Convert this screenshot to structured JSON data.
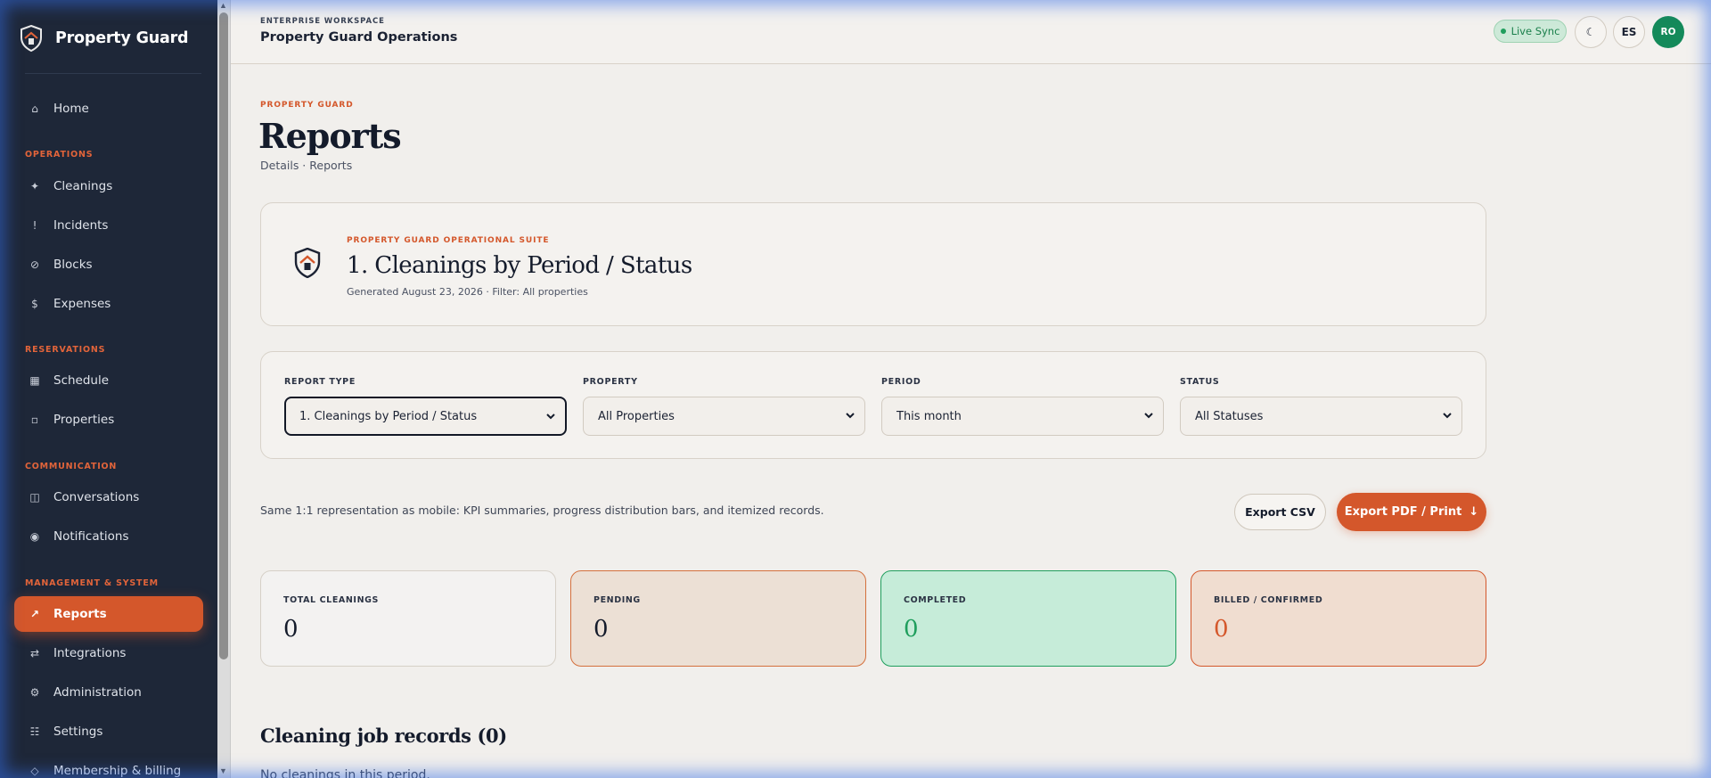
{
  "brand": {
    "name": "Property Guard"
  },
  "sidebar": {
    "sections": {
      "operations": "OPERATIONS",
      "reservations": "RESERVATIONS",
      "communication": "COMMUNICATION",
      "management": "MANAGEMENT & SYSTEM"
    },
    "items": {
      "home": {
        "label": "Home",
        "icon": "⌂"
      },
      "cleanings": {
        "label": "Cleanings",
        "icon": "✦"
      },
      "incidents": {
        "label": "Incidents",
        "icon": "!"
      },
      "blocks": {
        "label": "Blocks",
        "icon": "⊘"
      },
      "expenses": {
        "label": "Expenses",
        "icon": "$"
      },
      "schedule": {
        "label": "Schedule",
        "icon": "▦"
      },
      "properties": {
        "label": "Properties",
        "icon": "▫"
      },
      "conversations": {
        "label": "Conversations",
        "icon": "◫"
      },
      "notifications": {
        "label": "Notifications",
        "icon": "◉"
      },
      "reports": {
        "label": "Reports",
        "icon": "↗"
      },
      "integrations": {
        "label": "Integrations",
        "icon": "⇄"
      },
      "administration": {
        "label": "Administration",
        "icon": "⚙"
      },
      "settings": {
        "label": "Settings",
        "icon": "☷"
      },
      "membership": {
        "label": "Membership & billing",
        "icon": "◇"
      }
    }
  },
  "topbar": {
    "eyebrow": "ENTERPRISE WORKSPACE",
    "title": "Property Guard Operations",
    "live_sync": "Live Sync",
    "theme_icon": "☾",
    "lang": "ES",
    "avatar": "RO"
  },
  "page": {
    "eyebrow": "PROPERTY GUARD",
    "title": "Reports",
    "breadcrumb": "Details · Reports"
  },
  "report_header": {
    "eyebrow": "PROPERTY GUARD OPERATIONAL SUITE",
    "title": "1. Cleanings by Period / Status",
    "meta": "Generated August 23, 2026 · Filter: All properties"
  },
  "filters": {
    "report_type": {
      "label": "REPORT TYPE",
      "value": "1. Cleanings by Period / Status"
    },
    "property": {
      "label": "PROPERTY",
      "value": "All Properties"
    },
    "period": {
      "label": "PERIOD",
      "value": "This month"
    },
    "status": {
      "label": "STATUS",
      "value": "All Statuses"
    }
  },
  "note": "Same 1:1 representation as mobile: KPI summaries, progress distribution bars, and itemized records.",
  "actions": {
    "export_csv": "Export CSV",
    "export_pdf": "Export PDF / Print",
    "export_pdf_icon": "↓"
  },
  "kpis": {
    "total": {
      "label": "TOTAL CLEANINGS",
      "value": "0"
    },
    "pending": {
      "label": "PENDING",
      "value": "0"
    },
    "completed": {
      "label": "COMPLETED",
      "value": "0"
    },
    "billed": {
      "label": "BILLED / CONFIRMED",
      "value": "0"
    }
  },
  "records": {
    "title": "Cleaning job records (0)",
    "empty": "No cleanings in this period."
  },
  "colors": {
    "accent": "#d4572b",
    "sidebar_bg": "#1e2738",
    "success": "#1f9e5d",
    "page_bg": "#f1efec"
  }
}
